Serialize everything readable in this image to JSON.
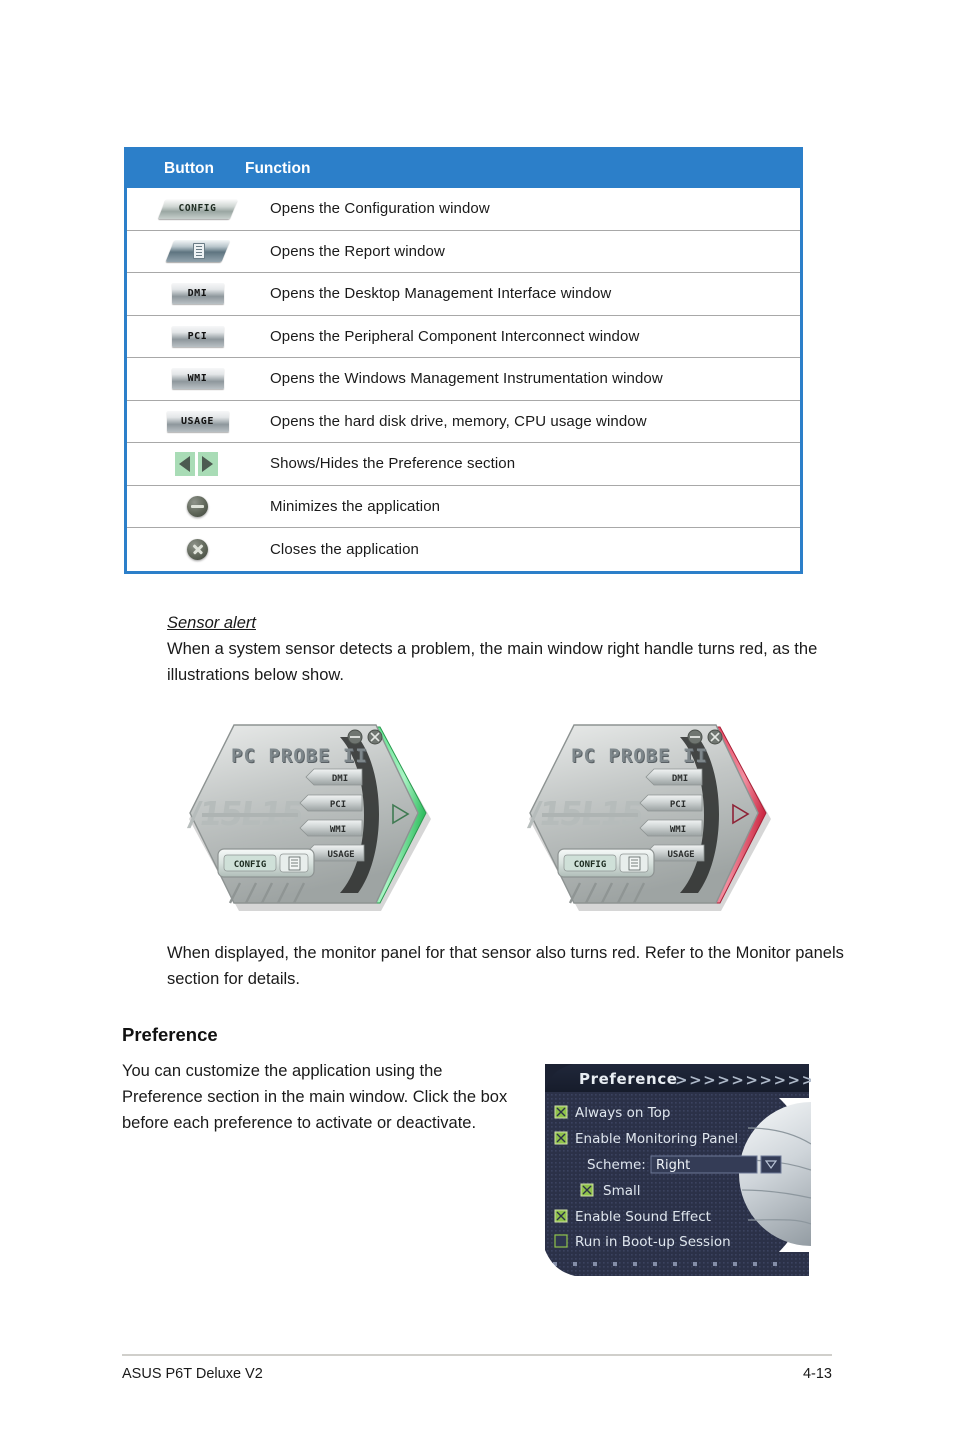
{
  "table": {
    "headers": {
      "button": "Button",
      "function": "Function"
    },
    "rows": [
      {
        "icon": "config-button-icon",
        "icon_label": "CONFIG",
        "function": "Opens the Configuration window"
      },
      {
        "icon": "report-button-icon",
        "icon_label": "",
        "function": "Opens the Report window"
      },
      {
        "icon": "dmi-button-icon",
        "icon_label": "DMI",
        "function": "Opens the Desktop Management Interface window"
      },
      {
        "icon": "pci-button-icon",
        "icon_label": "PCI",
        "function": "Opens the Peripheral Component Interconnect window"
      },
      {
        "icon": "wmi-button-icon",
        "icon_label": "WMI",
        "function": "Opens the Windows Management Instrumentation window"
      },
      {
        "icon": "usage-button-icon",
        "icon_label": "USAGE",
        "function": "Opens the hard disk drive, memory, CPU usage window"
      },
      {
        "icon": "show-hide-arrows-icon",
        "icon_label": "",
        "function": "Shows/Hides the Preference section"
      },
      {
        "icon": "minimize-icon",
        "icon_label": "",
        "function": "Minimizes the application"
      },
      {
        "icon": "close-icon",
        "icon_label": "",
        "function": "Closes the application"
      }
    ]
  },
  "sensor_alert": {
    "title": "Sensor alert",
    "body": "When a system sensor detects a problem, the main window right handle turns red, as the illustrations below show."
  },
  "monitor_note": "When displayed, the monitor panel for that sensor also turns red. Refer to the Monitor panels section for details.",
  "preference": {
    "heading": "Preference",
    "body": "You can customize the application using the Preference section in the main window. Click the box before each preference to activate or deactivate."
  },
  "probe_illustration": {
    "title": "PC PROBE II",
    "brand": "ASUS",
    "buttons": [
      "DMI",
      "PCI",
      "WMI",
      "USAGE"
    ],
    "config_label": "CONFIG",
    "handle_color_normal": "#4fd97e",
    "handle_color_alert": "#e8566e",
    "minimize_icon": "minimize-icon",
    "close_icon": "close-icon",
    "expand_icon": "expand-arrow-icon"
  },
  "preference_panel": {
    "title": "Preference",
    "chevrons": ">>>>>>>>>>>>",
    "items": [
      {
        "label": "Always on Top",
        "checked": true,
        "indent": 0
      },
      {
        "label": "Enable Monitoring Panel",
        "checked": true,
        "indent": 0
      },
      {
        "label": "Small",
        "checked": true,
        "indent": 2
      },
      {
        "label": "Enable Sound Effect",
        "checked": true,
        "indent": 0
      },
      {
        "label": "Run in Boot-up Session",
        "checked": false,
        "indent": 0
      }
    ],
    "scheme": {
      "label": "Scheme:",
      "value": "Right",
      "dropdown_icon": "chevron-down-icon"
    },
    "bg_color": "#2b3148",
    "accent_color": "#8fc24a"
  },
  "footer": {
    "left": "ASUS P6T Deluxe V2",
    "page": "4-13"
  }
}
